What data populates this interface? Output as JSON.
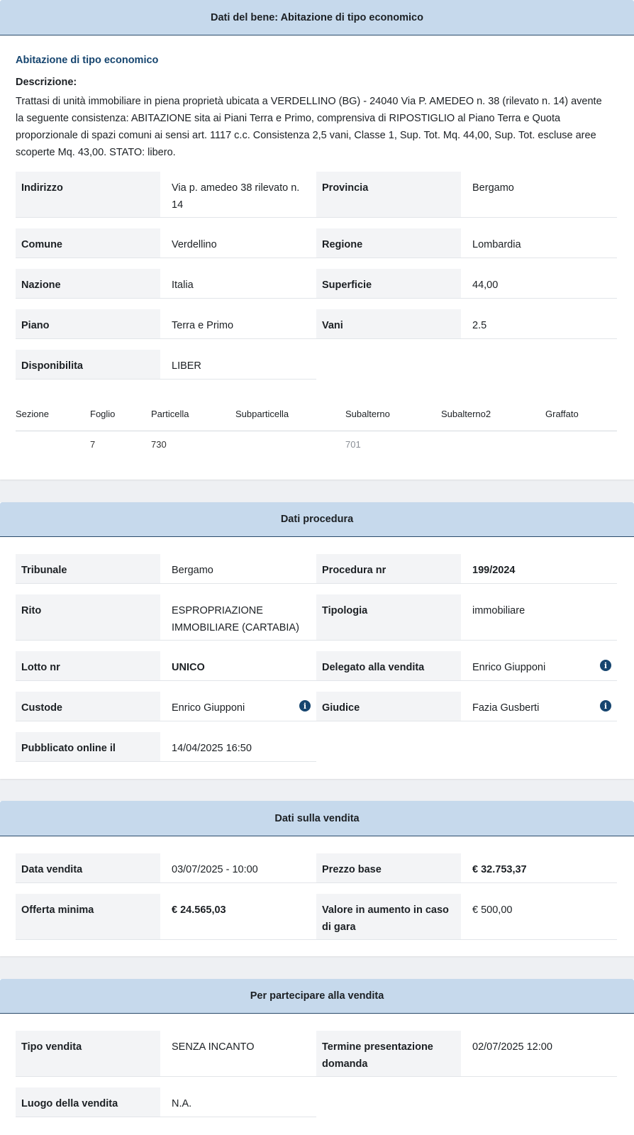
{
  "bene": {
    "header": "Dati del bene: Abitazione di tipo economico",
    "subtitle": "Abitazione di tipo economico",
    "desc_label": "Descrizione:",
    "desc_lines": [
      "Trattasi di unità immobiliare in piena proprietà ubicata a VERDELLINO (BG) - 24040 Via P. AMEDEO n. 38 (rilevato n. 14) avente",
      "la seguente consistenza: ABITAZIONE sita ai Piani Terra e Primo, comprensiva di RIPOSTIGLIO al Piano Terra e Quota",
      "proporzionale di spazi comuni ai sensi art. 1117 c.c. Consistenza 2,5 vani, Classe 1, Sup. Tot. Mq. 44,00, Sup. Tot. escluse aree",
      "scoperte Mq. 43,00. STATO: libero."
    ],
    "fields": {
      "indirizzo_label": "Indirizzo",
      "indirizzo_line1": "Via p. amedeo 38 rilevato n.",
      "indirizzo_line2": "14",
      "provincia_label": "Provincia",
      "provincia": "Bergamo",
      "comune_label": "Comune",
      "comune": "Verdellino",
      "regione_label": "Regione",
      "regione": "Lombardia",
      "nazione_label": "Nazione",
      "nazione": "Italia",
      "superficie_label": "Superficie",
      "superficie": "44,00",
      "piano_label": "Piano",
      "piano": "Terra e Primo",
      "vani_label": "Vani",
      "vani": "2.5",
      "disponibilita_label": "Disponibilita",
      "disponibilita": "LIBER"
    },
    "catasto": {
      "headers": [
        "Sezione",
        "Foglio",
        "Particella",
        "Subparticella",
        "Subalterno",
        "Subalterno2",
        "Graffato"
      ],
      "row": [
        "",
        "7",
        "730",
        "",
        "701",
        "",
        ""
      ]
    }
  },
  "procedura": {
    "header": "Dati procedura",
    "tribunale_label": "Tribunale",
    "tribunale": "Bergamo",
    "procedura_label": "Procedura nr",
    "procedura": "199/2024",
    "rito_label": "Rito",
    "rito_line1": "ESPROPRIAZIONE",
    "rito_line2": "IMMOBILIARE (CARTABIA)",
    "tipologia_label": "Tipologia",
    "tipologia": "immobiliare",
    "lotto_label": "Lotto nr",
    "lotto": "UNICO",
    "delegato_label": "Delegato alla vendita",
    "delegato": "Enrico Giupponi",
    "custode_label": "Custode",
    "custode": "Enrico Giupponi",
    "giudice_label": "Giudice",
    "giudice": "Fazia Gusberti",
    "pubblicato_label": "Pubblicato online il",
    "pubblicato": "14/04/2025 16:50"
  },
  "vendita": {
    "header": "Dati sulla vendita",
    "data_label": "Data vendita",
    "data": "03/07/2025 - 10:00",
    "prezzo_label": "Prezzo base",
    "prezzo": "€ 32.753,37",
    "offerta_label": "Offerta minima",
    "offerta": "€ 24.565,03",
    "aumento_label_line1": "Valore in aumento in caso",
    "aumento_label_line2": "di gara",
    "aumento": "€ 500,00"
  },
  "partecipare": {
    "header": "Per partecipare alla vendita",
    "tipo_label": "Tipo vendita",
    "tipo": "SENZA INCANTO",
    "termine_label_line1": "Termine presentazione",
    "termine_label_line2": "domanda",
    "termine": "02/07/2025 12:00",
    "luogo_label": "Luogo della vendita",
    "luogo": "N.A."
  },
  "colors": {
    "header_bg": "#c6d9ec",
    "accent": "#16456f",
    "label_bg": "#f3f4f6"
  },
  "icons": [
    "info-icon"
  ]
}
